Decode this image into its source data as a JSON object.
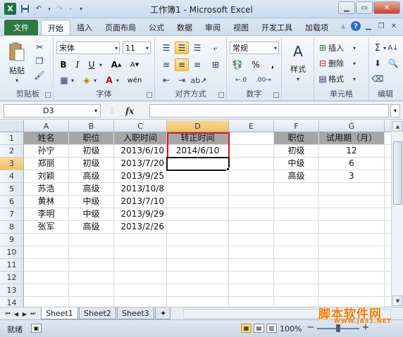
{
  "window": {
    "title": "工作簿1 - Microsoft Excel",
    "min_glyph": "▁",
    "max_glyph": "▭",
    "close_glyph": "✕"
  },
  "ribbon_tabs": [
    "开始",
    "插入",
    "页面布局",
    "公式",
    "数据",
    "审阅",
    "视图",
    "开发工具",
    "加载项"
  ],
  "file_tab": "文件",
  "active_tab": "开始",
  "ribbon": {
    "clipboard": {
      "label": "剪贴板",
      "paste": "粘贴"
    },
    "font": {
      "label": "字体",
      "font_name": "宋体",
      "font_size": "11"
    },
    "alignment": {
      "label": "对齐方式"
    },
    "number": {
      "label": "数字",
      "format": "常规"
    },
    "styles": {
      "label": "样式",
      "button": "样式"
    },
    "cells": {
      "label": "单元格",
      "insert": "插入",
      "delete": "删除",
      "format": "格式"
    },
    "editing": {
      "label": "编辑"
    }
  },
  "formula_bar": {
    "name_box": "D3",
    "fx": "fx",
    "formula": ""
  },
  "columns": [
    "A",
    "B",
    "C",
    "D",
    "E",
    "F",
    "G"
  ],
  "rows": [
    "1",
    "2",
    "3",
    "4",
    "5",
    "6",
    "7",
    "8",
    "9",
    "10",
    "11",
    "12",
    "13",
    "14"
  ],
  "table1": {
    "headers": [
      "姓名",
      "职位",
      "入职时间",
      "转正时间"
    ],
    "rows": [
      [
        "孙宁",
        "初级",
        "2013/6/10",
        "2014/6/10"
      ],
      [
        "郑丽",
        "初级",
        "2013/7/20",
        ""
      ],
      [
        "刘颖",
        "高级",
        "2013/9/25",
        ""
      ],
      [
        "苏浩",
        "高级",
        "2013/10/8",
        ""
      ],
      [
        "黄林",
        "中级",
        "2013/7/10",
        ""
      ],
      [
        "李明",
        "中级",
        "2013/9/29",
        ""
      ],
      [
        "张军",
        "高级",
        "2013/2/26",
        ""
      ]
    ]
  },
  "table2": {
    "headers": [
      "职位",
      "试用期（月）"
    ],
    "rows": [
      [
        "初级",
        "12"
      ],
      [
        "中级",
        "6"
      ],
      [
        "高级",
        "3"
      ]
    ]
  },
  "sheet_tabs": [
    "Sheet1",
    "Sheet2",
    "Sheet3"
  ],
  "active_sheet": "Sheet1",
  "status": {
    "text": "就绪",
    "zoom": "100%"
  },
  "watermark": {
    "main": "脚本软件网",
    "sub": "WWW.JB51.NET"
  }
}
